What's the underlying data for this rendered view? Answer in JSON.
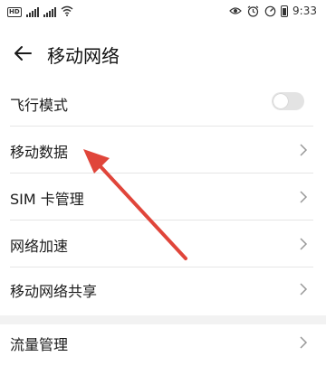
{
  "status_bar": {
    "left_badge": "HD",
    "time": "9:33"
  },
  "header": {
    "title": "移动网络"
  },
  "settings": {
    "items": [
      {
        "label": "飞行模式",
        "control": "toggle",
        "checked": false
      },
      {
        "label": "移动数据",
        "control": "chevron"
      },
      {
        "label": "SIM 卡管理",
        "control": "chevron"
      },
      {
        "label": "网络加速",
        "control": "chevron"
      },
      {
        "label": "移动网络共享",
        "control": "chevron"
      },
      {
        "label": "流量管理",
        "control": "chevron"
      }
    ]
  },
  "icons": [
    "back-arrow-icon",
    "signal-icon",
    "wifi-icon",
    "eye-icon",
    "alarm-icon",
    "speedometer-icon",
    "battery-icon",
    "chevron-right-icon",
    "annotation-arrow-icon"
  ],
  "colors": {
    "annotation_arrow": "#e0453a",
    "toggle_off": "#e3e3e3",
    "section_gap": "#f2f2f2"
  }
}
